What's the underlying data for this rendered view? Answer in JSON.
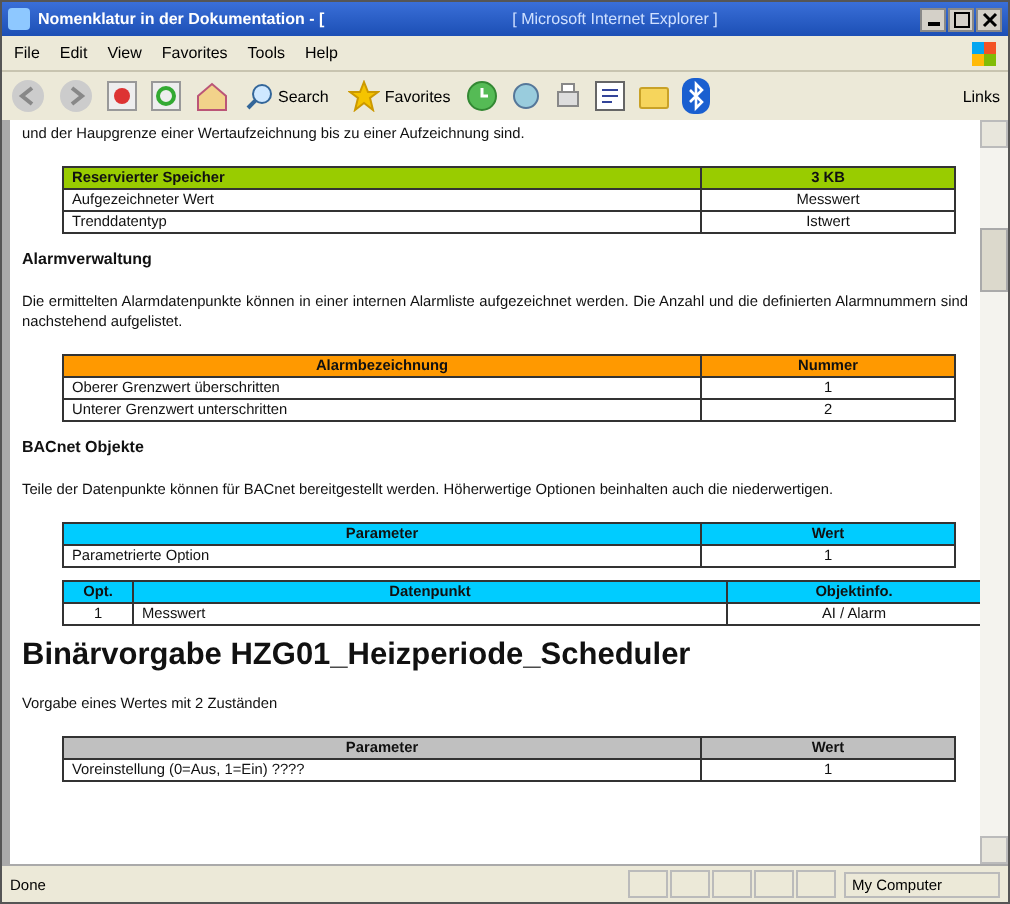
{
  "window": {
    "title": "Nomenklatur in der Dokumentation - [",
    "title_2": "[ Microsoft Internet Explorer ]"
  },
  "menu": [
    "File",
    "Edit",
    "View",
    "Favorites",
    "Tools",
    "Help"
  ],
  "toolbar": {
    "search": "Search",
    "favorites": "Favorites",
    "links": "Links"
  },
  "content": [
    {
      "kind": "text",
      "text": "und der Haupgrenze einer Wertaufzeichnung bis zu einer Aufzeichnung sind."
    },
    {
      "kind": "table",
      "columns": [
        "Reservierter Speicher",
        "3 KB"
      ],
      "rows": [
        [
          "Aufgezeichneter Wert",
          "Messwert"
        ],
        [
          "Trenddatentyp",
          "Istwert"
        ]
      ]
    },
    {
      "kind": "subheading",
      "text": "Alarmverwaltung"
    },
    {
      "kind": "text",
      "text": "Die ermittelten Alarmdatenpunkte können in einer internen Alarmliste aufgezeichnet werden. Die Anzahl und die definierten Alarmnummern sind nachstehend aufgelistet."
    },
    {
      "kind": "table",
      "columns": [
        "Alarmbezeichnung",
        "Nummer"
      ],
      "rows": [
        [
          "Oberer Grenzwert überschritten",
          "1"
        ],
        [
          "Unterer Grenzwert unterschritten",
          "2"
        ]
      ]
    },
    {
      "kind": "subheading",
      "text": "BACnet Objekte"
    },
    {
      "kind": "text",
      "text": "Teile der Datenpunkte können für BACnet bereitgestellt werden. Höherwertige Optionen beinhalten auch die niederwertigen."
    },
    {
      "kind": "table",
      "columns": [
        "Parameter",
        "Wert"
      ],
      "rows": [
        [
          "Parametrierte Option",
          "1"
        ]
      ]
    },
    {
      "kind": "table",
      "columns": [
        "Opt.",
        "Datenpunkt",
        "Objektinfo."
      ],
      "rows": [
        [
          "1",
          "Messwert",
          "AI / Alarm"
        ]
      ]
    },
    {
      "kind": "heading",
      "text": "Binärvorgabe HZG01_Heizperiode_Scheduler"
    },
    {
      "kind": "text",
      "text": "Vorgabe eines Wertes mit 2 Zuständen"
    },
    {
      "kind": "table",
      "columns": [
        "Parameter",
        "Wert"
      ],
      "rows": [
        [
          "Voreinstellung (0=Aus, 1=Ein) ????",
          "1"
        ]
      ]
    }
  ],
  "status_bar": {
    "text": "Done",
    "zone": "My Computer"
  }
}
